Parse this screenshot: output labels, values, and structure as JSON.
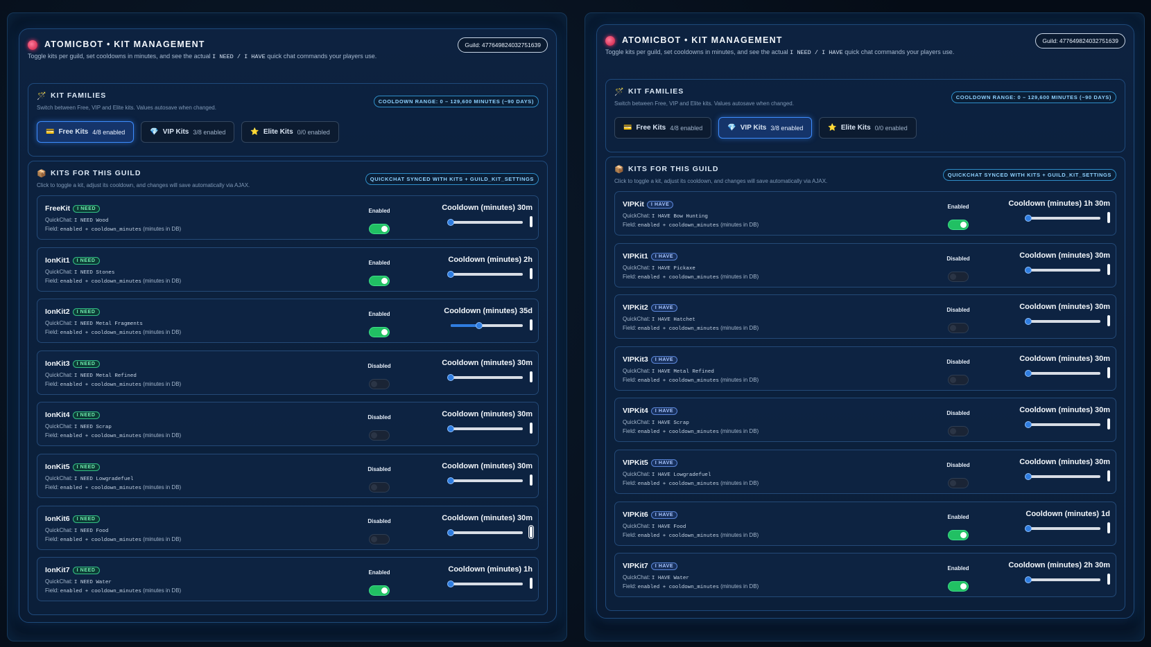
{
  "left": {
    "header": {
      "title": "ATOMICBOT • KIT MANAGEMENT",
      "sub_pre": "Toggle kits per guild, set cooldowns in minutes, and see the actual",
      "sub_code": "I NEED / I HAVE",
      "sub_post": "quick chat commands your players use.",
      "guild": "Guild: 477649824032751639"
    },
    "families": {
      "icon": "wand-icon",
      "title": "KIT FAMILIES",
      "sub": "Switch between Free, VIP and Elite kits. Values autosave when changed.",
      "range": "COOLDOWN RANGE: 0 – 129,600 MINUTES (~90 DAYS)",
      "tabs": [
        {
          "label": "Free Kits",
          "count": "4/8 enabled",
          "icon": "card-icon",
          "active": true
        },
        {
          "label": "VIP Kits",
          "count": "3/8 enabled",
          "icon": "diamond-icon",
          "active": false
        },
        {
          "label": "Elite Kits",
          "count": "0/0 enabled",
          "icon": "star-icon",
          "active": false
        }
      ]
    },
    "kits": {
      "icon": "box-icon",
      "title": "KITS FOR THIS GUILD",
      "sub": "Click to toggle a kit, adjust its cooldown, and changes will save automatically via AJAX.",
      "sync": "QUICKCHAT SYNCED WITH KITS + GUILD_KIT_SETTINGS",
      "items": [
        {
          "name": "FreeKit",
          "badge": "I NEED",
          "qc_label": "QuickChat:",
          "qc": "I NEED Wood",
          "field_label": "Field:",
          "field": "enabled + cooldown_minutes",
          "field_post": "(minutes in DB)",
          "state": "Enabled",
          "enabled": true,
          "cooldown": "Cooldown (minutes) 30m",
          "slider": 0.0,
          "focus": false
        },
        {
          "name": "IonKit1",
          "badge": "I NEED",
          "qc_label": "QuickChat:",
          "qc": "I NEED Stones",
          "field_label": "Field:",
          "field": "enabled + cooldown_minutes",
          "field_post": "(minutes in DB)",
          "state": "Enabled",
          "enabled": true,
          "cooldown": "Cooldown (minutes) 2h",
          "slider": 0.0,
          "focus": false
        },
        {
          "name": "IonKit2",
          "badge": "I NEED",
          "qc_label": "QuickChat:",
          "qc": "I NEED Metal Fragments",
          "field_label": "Field:",
          "field": "enabled + cooldown_minutes",
          "field_post": "(minutes in DB)",
          "state": "Enabled",
          "enabled": true,
          "cooldown": "Cooldown (minutes) 35d",
          "slider": 0.39,
          "focus": false
        },
        {
          "name": "IonKit3",
          "badge": "I NEED",
          "qc_label": "QuickChat:",
          "qc": "I NEED Metal Refined",
          "field_label": "Field:",
          "field": "enabled + cooldown_minutes",
          "field_post": "(minutes in DB)",
          "state": "Disabled",
          "enabled": false,
          "cooldown": "Cooldown (minutes) 30m",
          "slider": 0.0,
          "focus": false
        },
        {
          "name": "IonKit4",
          "badge": "I NEED",
          "qc_label": "QuickChat:",
          "qc": "I NEED Scrap",
          "field_label": "Field:",
          "field": "enabled + cooldown_minutes",
          "field_post": "(minutes in DB)",
          "state": "Disabled",
          "enabled": false,
          "cooldown": "Cooldown (minutes) 30m",
          "slider": 0.0,
          "focus": false
        },
        {
          "name": "IonKit5",
          "badge": "I NEED",
          "qc_label": "QuickChat:",
          "qc": "I NEED Lowgradefuel",
          "field_label": "Field:",
          "field": "enabled + cooldown_minutes",
          "field_post": "(minutes in DB)",
          "state": "Disabled",
          "enabled": false,
          "cooldown": "Cooldown (minutes) 30m",
          "slider": 0.0,
          "focus": false
        },
        {
          "name": "IonKit6",
          "badge": "I NEED",
          "qc_label": "QuickChat:",
          "qc": "I NEED Food",
          "field_label": "Field:",
          "field": "enabled + cooldown_minutes",
          "field_post": "(minutes in DB)",
          "state": "Disabled",
          "enabled": false,
          "cooldown": "Cooldown (minutes) 30m",
          "slider": 0.0,
          "focus": true
        },
        {
          "name": "IonKit7",
          "badge": "I NEED",
          "qc_label": "QuickChat:",
          "qc": "I NEED Water",
          "field_label": "Field:",
          "field": "enabled + cooldown_minutes",
          "field_post": "(minutes in DB)",
          "state": "Enabled",
          "enabled": true,
          "cooldown": "Cooldown (minutes) 1h",
          "slider": 0.0,
          "focus": false
        }
      ]
    }
  },
  "right": {
    "header": {
      "title": "ATOMICBOT • KIT MANAGEMENT",
      "sub_pre": "Toggle kits per guild, set cooldowns in minutes, and see the actual",
      "sub_code": "I NEED / I HAVE",
      "sub_post": "quick chat commands your players use.",
      "guild": "Guild: 477649824032751639"
    },
    "families": {
      "icon": "wand-icon",
      "title": "KIT FAMILIES",
      "sub": "Switch between Free, VIP and Elite kits. Values autosave when changed.",
      "range": "COOLDOWN RANGE: 0 – 129,600 MINUTES (~90 DAYS)",
      "tabs": [
        {
          "label": "Free Kits",
          "count": "4/8 enabled",
          "icon": "card-icon",
          "active": false
        },
        {
          "label": "VIP Kits",
          "count": "3/8 enabled",
          "icon": "diamond-icon",
          "active": true
        },
        {
          "label": "Elite Kits",
          "count": "0/0 enabled",
          "icon": "star-icon",
          "active": false
        }
      ]
    },
    "kits": {
      "icon": "box-icon",
      "title": "KITS FOR THIS GUILD",
      "sub": "Click to toggle a kit, adjust its cooldown, and changes will save automatically via AJAX.",
      "sync": "QUICKCHAT SYNCED WITH KITS + GUILD_KIT_SETTINGS",
      "items": [
        {
          "name": "VIPKit",
          "badge": "I HAVE",
          "qc_label": "QuickChat:",
          "qc": "I HAVE Bow Hunting",
          "field_label": "Field:",
          "field": "enabled + cooldown_minutes",
          "field_post": "(minutes in DB)",
          "state": "Enabled",
          "enabled": true,
          "cooldown": "Cooldown (minutes) 1h 30m",
          "slider": 0.0,
          "focus": false
        },
        {
          "name": "VIPKit1",
          "badge": "I HAVE",
          "qc_label": "QuickChat:",
          "qc": "I HAVE Pickaxe",
          "field_label": "Field:",
          "field": "enabled + cooldown_minutes",
          "field_post": "(minutes in DB)",
          "state": "Disabled",
          "enabled": false,
          "cooldown": "Cooldown (minutes) 30m",
          "slider": 0.0,
          "focus": false
        },
        {
          "name": "VIPKit2",
          "badge": "I HAVE",
          "qc_label": "QuickChat:",
          "qc": "I HAVE Hatchet",
          "field_label": "Field:",
          "field": "enabled + cooldown_minutes",
          "field_post": "(minutes in DB)",
          "state": "Disabled",
          "enabled": false,
          "cooldown": "Cooldown (minutes) 30m",
          "slider": 0.0,
          "focus": false
        },
        {
          "name": "VIPKit3",
          "badge": "I HAVE",
          "qc_label": "QuickChat:",
          "qc": "I HAVE Metal Refined",
          "field_label": "Field:",
          "field": "enabled + cooldown_minutes",
          "field_post": "(minutes in DB)",
          "state": "Disabled",
          "enabled": false,
          "cooldown": "Cooldown (minutes) 30m",
          "slider": 0.0,
          "focus": false
        },
        {
          "name": "VIPKit4",
          "badge": "I HAVE",
          "qc_label": "QuickChat:",
          "qc": "I HAVE Scrap",
          "field_label": "Field:",
          "field": "enabled + cooldown_minutes",
          "field_post": "(minutes in DB)",
          "state": "Disabled",
          "enabled": false,
          "cooldown": "Cooldown (minutes) 30m",
          "slider": 0.0,
          "focus": false
        },
        {
          "name": "VIPKit5",
          "badge": "I HAVE",
          "qc_label": "QuickChat:",
          "qc": "I HAVE Lowgradefuel",
          "field_label": "Field:",
          "field": "enabled + cooldown_minutes",
          "field_post": "(minutes in DB)",
          "state": "Disabled",
          "enabled": false,
          "cooldown": "Cooldown (minutes) 30m",
          "slider": 0.0,
          "focus": false
        },
        {
          "name": "VIPKit6",
          "badge": "I HAVE",
          "qc_label": "QuickChat:",
          "qc": "I HAVE Food",
          "field_label": "Field:",
          "field": "enabled + cooldown_minutes",
          "field_post": "(minutes in DB)",
          "state": "Enabled",
          "enabled": true,
          "cooldown": "Cooldown (minutes) 1d",
          "slider": 0.0,
          "focus": false
        },
        {
          "name": "VIPKit7",
          "badge": "I HAVE",
          "qc_label": "QuickChat:",
          "qc": "I HAVE Water",
          "field_label": "Field:",
          "field": "enabled + cooldown_minutes",
          "field_post": "(minutes in DB)",
          "state": "Enabled",
          "enabled": true,
          "cooldown": "Cooldown (minutes) 2h 30m",
          "slider": 0.0,
          "focus": false
        }
      ]
    }
  }
}
